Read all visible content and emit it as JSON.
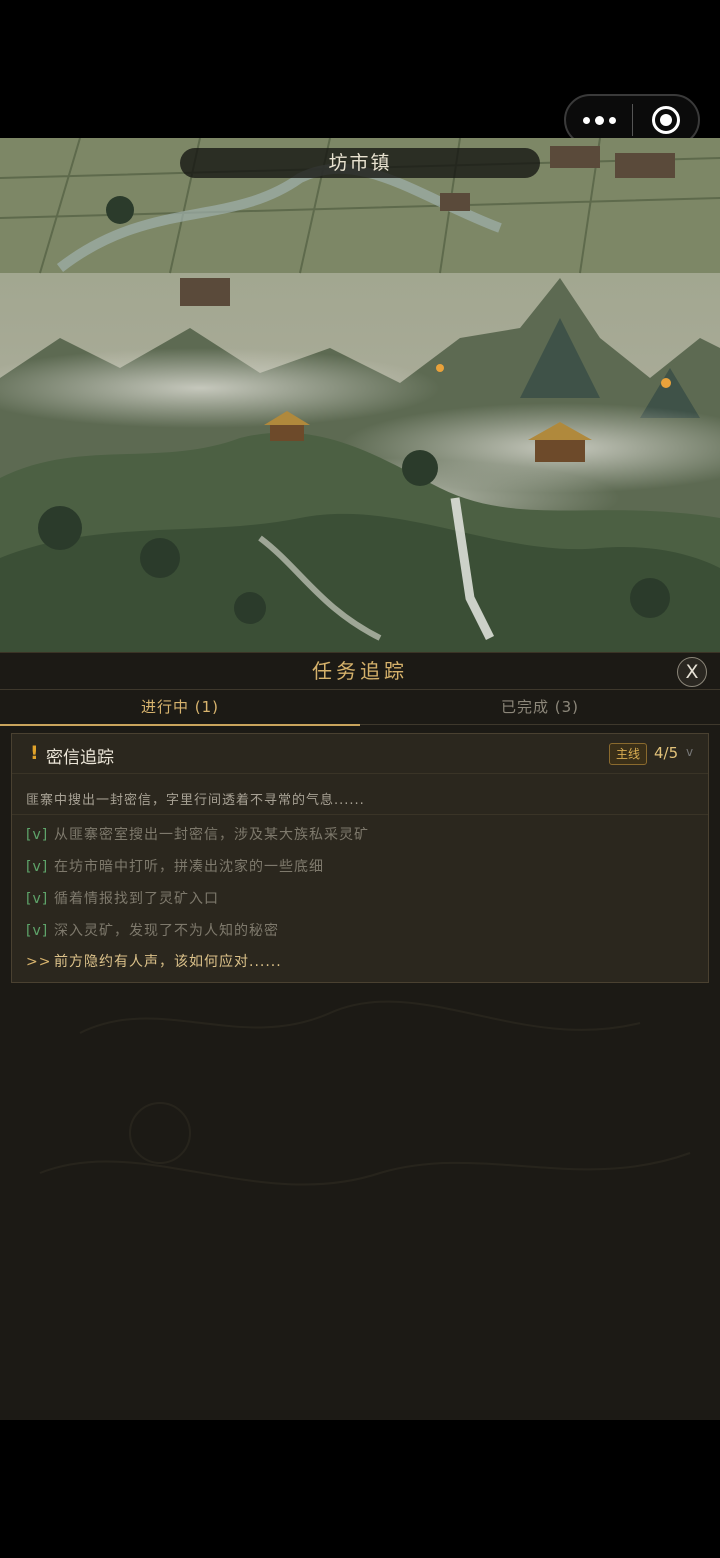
{
  "capsule": {
    "more_icon": "more-dots-icon",
    "exit_icon": "target-exit-icon"
  },
  "map": {
    "location": "坊市镇"
  },
  "panel": {
    "title": "任务追踪",
    "close_label": "X",
    "tabs": [
      {
        "label": "进行中 (1)",
        "active": true
      },
      {
        "label": "已完成 (3)",
        "active": false
      }
    ]
  },
  "quest": {
    "alert": "!",
    "name": "密信追踪",
    "badge": "主线",
    "progress": "4/5",
    "expand": "v",
    "summary": "匪寨中搜出一封密信，字里行间透着不寻常的气息......",
    "steps": [
      {
        "marker": "[v]",
        "text": "从匪寨密室搜出一封密信，涉及某大族私采灵矿"
      },
      {
        "marker": "[v]",
        "text": "在坊市暗中打听，拼凑出沈家的一些底细"
      },
      {
        "marker": "[v]",
        "text": "循着情报找到了灵矿入口"
      },
      {
        "marker": "[v]",
        "text": "深入灵矿，发现了不为人知的秘密"
      },
      {
        "marker": ">>",
        "text": "前方隐约有人声，该如何应对......"
      }
    ]
  },
  "colors": {
    "gold": "#d8b46e",
    "done_green": "#5ea46a",
    "panel_bg": "#1c1a15"
  }
}
